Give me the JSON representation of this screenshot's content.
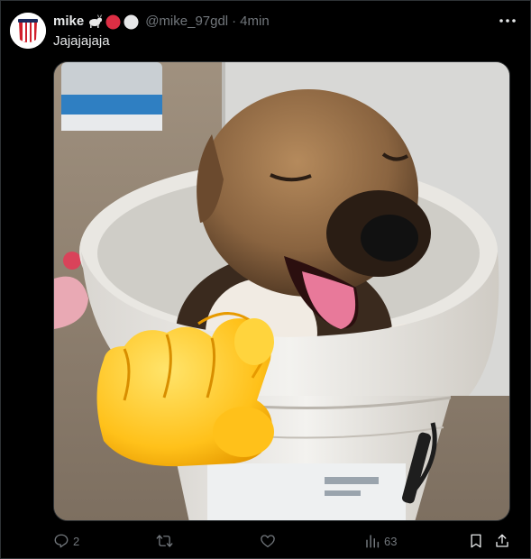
{
  "tweet": {
    "display_name": "mike",
    "handle": "@mike_97gdl",
    "separator": "·",
    "time": "4min",
    "text": "Jajajajaja",
    "name_emojis": [
      "goat-emoji",
      "red-circle-emoji",
      "white-circle-emoji"
    ]
  },
  "actions": {
    "replies": "2",
    "reposts": "",
    "likes": "",
    "views": "63"
  },
  "icons": {
    "more": "more-dots-icon",
    "reply": "reply-icon",
    "repost": "repost-icon",
    "like": "heart-icon",
    "views": "views-chart-icon",
    "bookmark": "bookmark-icon",
    "share": "share-icon"
  },
  "colors": {
    "background": "#000000",
    "text_primary": "#e7e9ea",
    "text_secondary": "#71767b",
    "border": "#2f3336"
  }
}
